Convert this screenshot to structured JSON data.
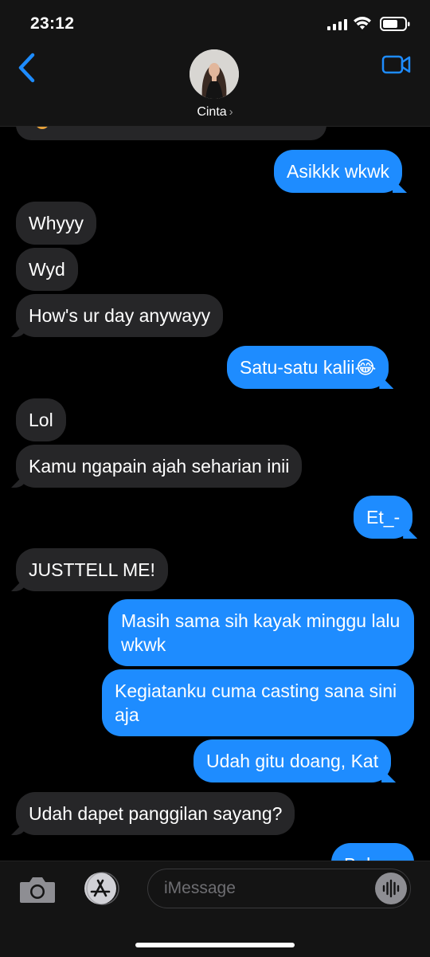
{
  "status": {
    "time": "23:12"
  },
  "contact": {
    "name": "Cinta"
  },
  "messages": [
    {
      "from": "them",
      "text": "Whyyy"
    },
    {
      "from": "them",
      "text": "Wyd"
    },
    {
      "from": "them",
      "text": "How's ur day anywayy"
    },
    {
      "from": "me",
      "text": "Asikkk wkwk"
    },
    {
      "from": "me",
      "text": "Satu-satu kalii😂"
    },
    {
      "from": "them",
      "text": "Lol"
    },
    {
      "from": "them",
      "text": "Kamu ngapain ajah seharian inii"
    },
    {
      "from": "me",
      "text": "Et_-"
    },
    {
      "from": "them",
      "text": "JUSTTELL ME!"
    },
    {
      "from": "me",
      "text": "Masih sama sih kayak minggu lalu wkwk"
    },
    {
      "from": "me",
      "text": "Kegiatanku cuma casting sana sini aja"
    },
    {
      "from": "me",
      "text": "Udah gitu doang, Kat"
    },
    {
      "from": "them",
      "text": "Udah dapet panggilan sayang?"
    },
    {
      "from": "me",
      "text": "Bel..."
    }
  ],
  "composer": {
    "placeholder": "iMessage"
  },
  "colors": {
    "outgoing": "#1e8cff",
    "incoming": "#262628",
    "accent": "#1e8cff"
  },
  "icons": [
    "back-chevron-icon",
    "video-camera-icon",
    "camera-icon",
    "app-store-icon",
    "audio-waveform-icon"
  ]
}
